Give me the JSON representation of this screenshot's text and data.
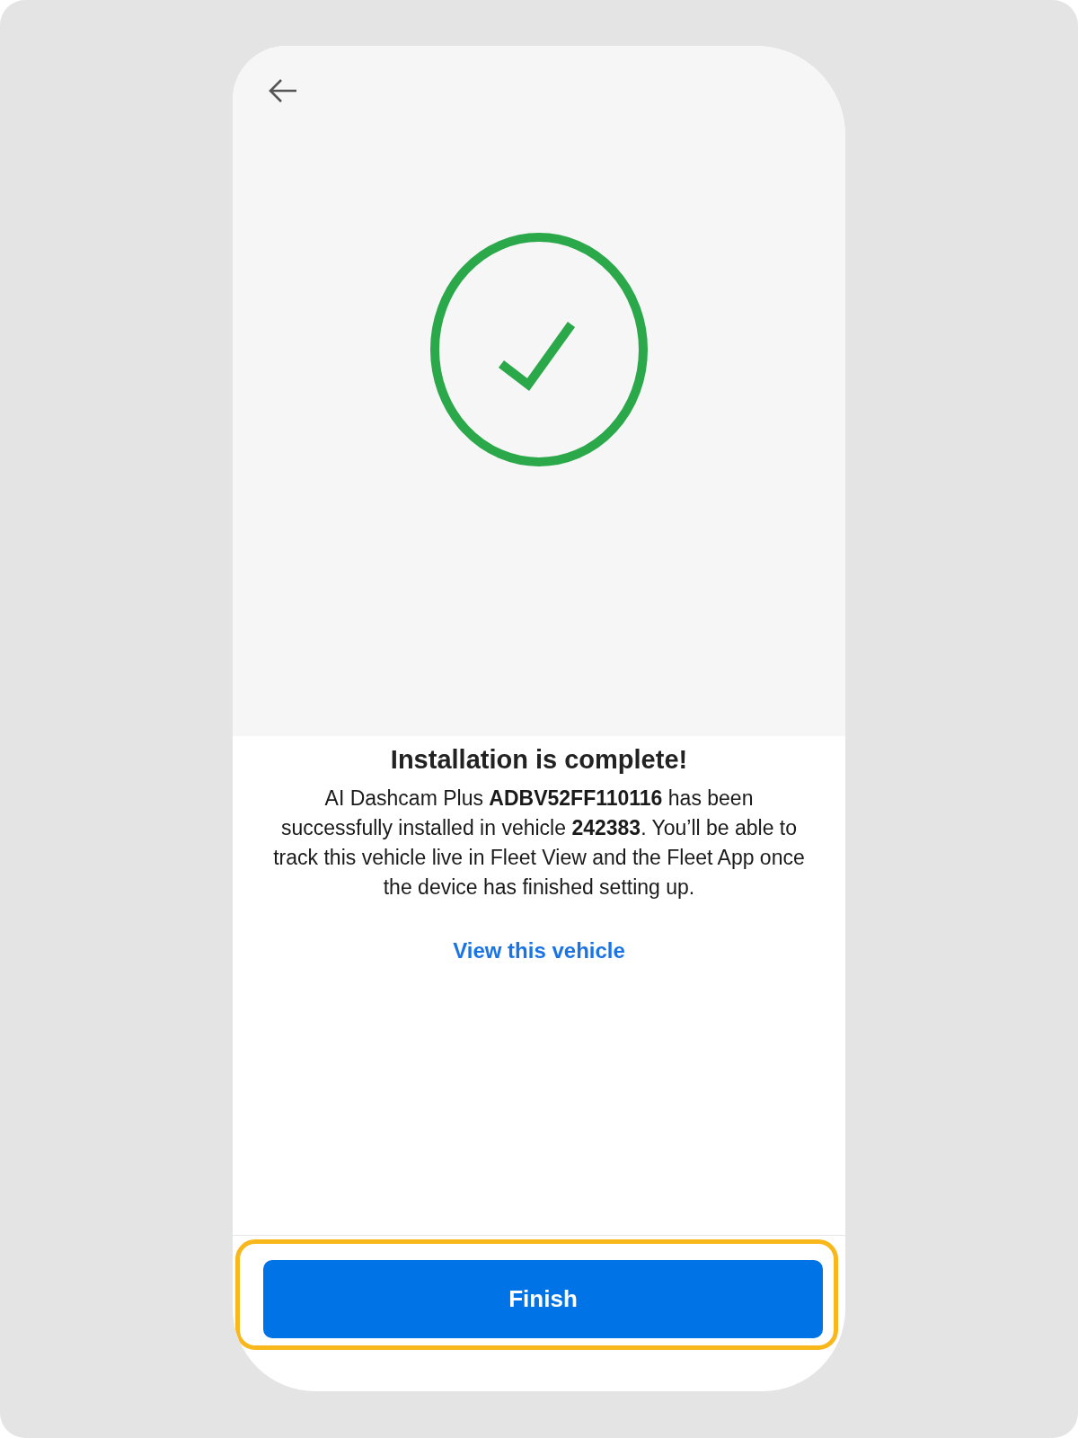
{
  "header": {
    "back_button": {
      "kind": "arrow"
    }
  },
  "status": {
    "kind": "success"
  },
  "message": {
    "title": "Installation is complete!",
    "body": "AI Dashcam Plus **ADBV52FF110116** has been successfully installed in vehicle **242383**. You’ll be able to track this vehicle live in Fleet View and the Fleet App once the device has finished setting up."
  },
  "link": "View this vehicle",
  "footer": {
    "button": "Finish",
    "highlighted": true
  }
}
